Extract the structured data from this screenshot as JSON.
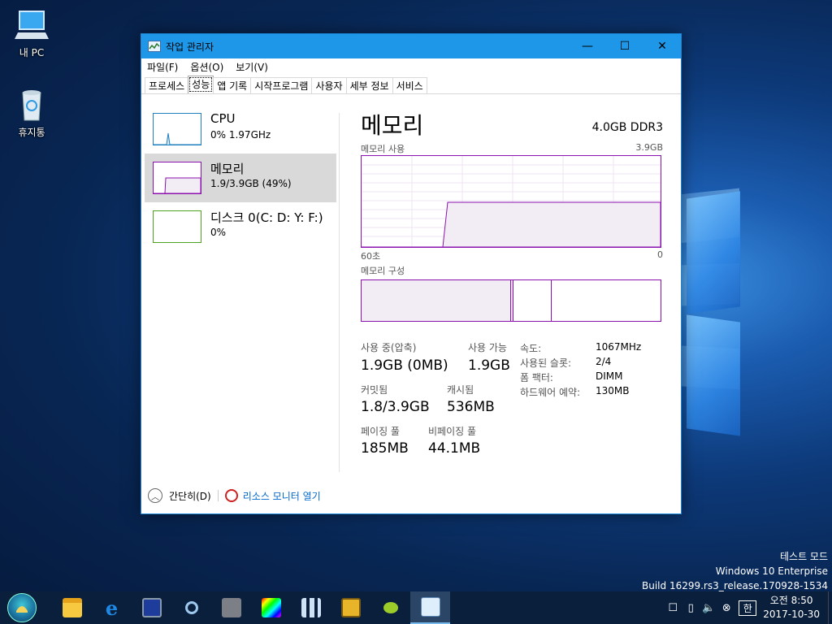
{
  "desktop": {
    "icons": [
      {
        "label": "내 PC",
        "icon": "computer-icon"
      },
      {
        "label": "휴지통",
        "icon": "recycle-bin-icon"
      }
    ]
  },
  "window": {
    "title": "작업 관리자",
    "controls": {
      "minimize": "—",
      "maximize": "☐",
      "close": "✕"
    },
    "menu": [
      "파일(F)",
      "옵션(O)",
      "보기(V)"
    ],
    "tabs": [
      "프로세스",
      "성능",
      "앱 기록",
      "시작프로그램",
      "사용자",
      "세부 정보",
      "서비스"
    ],
    "active_tab": "성능"
  },
  "sidebar": {
    "items": [
      {
        "name": "CPU",
        "sub": "0% 1.97GHz",
        "color": "#1f7fbf",
        "selected": false
      },
      {
        "name": "메모리",
        "sub": "1.9/3.9GB (49%)",
        "color": "#8b12ae",
        "selected": true
      },
      {
        "name": "디스크 0(C: D: Y: F:)",
        "sub": "0%",
        "color": "#4da321",
        "selected": false
      }
    ]
  },
  "memory": {
    "title": "메모리",
    "spec": "4.0GB DDR3",
    "usage_label": "메모리 사용",
    "usage_max": "3.9GB",
    "axis_left": "60초",
    "axis_right": "0",
    "composition_label": "메모리 구성",
    "usage_fraction": 0.49,
    "stats": {
      "in_use_label": "사용 중(압축)",
      "in_use_value": "1.9GB (0MB)",
      "available_label": "사용 가능",
      "available_value": "1.9GB",
      "committed_label": "커밋됨",
      "committed_value": "1.8/3.9GB",
      "cached_label": "캐시됨",
      "cached_value": "536MB",
      "paged_label": "페이징 풀",
      "paged_value": "185MB",
      "nonpaged_label": "비페이징 풀",
      "nonpaged_value": "44.1MB"
    },
    "details": {
      "speed_label": "속도:",
      "speed_value": "1067MHz",
      "slots_label": "사용된 슬롯:",
      "slots_value": "2/4",
      "form_label": "폼 팩터:",
      "form_value": "DIMM",
      "reserved_label": "하드웨어 예약:",
      "reserved_value": "130MB"
    }
  },
  "footer": {
    "collapse_label": "간단히(D)",
    "resource_monitor_label": "리소스 모니터 열기"
  },
  "watermark": {
    "line1": "테스트 모드",
    "line2": "Windows 10 Enterprise",
    "line3": "Build 16299.rs3_release.170928-1534"
  },
  "taskbar": {
    "apps": [
      "file-explorer-icon",
      "internet-explorer-icon",
      "save-disk-icon",
      "search-magnifier-icon",
      "robot-app-icon",
      "color-picker-icon",
      "network-app-icon",
      "r-app-icon",
      "green-app-icon",
      "task-manager-icon"
    ],
    "tray_icons": [
      "notification-icon",
      "usb-icon",
      "volume-icon",
      "mute-x-icon"
    ],
    "ime": "한",
    "time": "오전 8:50",
    "date": "2017-10-30"
  },
  "colors": {
    "memory_accent": "#8b12ae",
    "cpu_accent": "#1f7fbf",
    "disk_accent": "#4da321",
    "titlebar": "#1e97e8"
  }
}
